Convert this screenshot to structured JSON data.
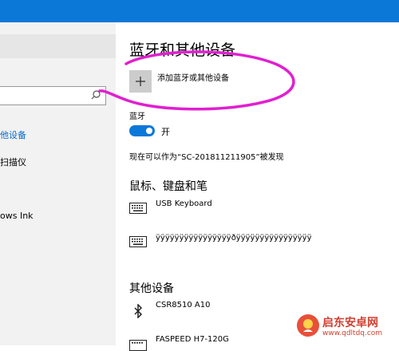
{
  "sidebar": {
    "search": {
      "placeholder": ""
    },
    "items": [
      {
        "label": "他设备"
      },
      {
        "label": "扫描仪"
      },
      {
        "label": "ows Ink"
      }
    ]
  },
  "main": {
    "title": "蓝牙和其他设备",
    "add_device_label": "添加蓝牙或其他设备",
    "bluetooth": {
      "label": "蓝牙",
      "toggle_state": "开",
      "discoverable_text": "现在可以作为“SC-201811211905”被发现"
    },
    "mouse_keyboard": {
      "title": "鼠标、键盘和笔",
      "devices": [
        {
          "name": "USB Keyboard",
          "icon": "keyboard-icon"
        },
        {
          "name": "ÿÿÿÿÿÿÿÿÿÿÿÿÿÿÿÿðÿÿÿÿÿÿÿÿÿÿÿÿÿÿÿÿ",
          "icon": "keyboard-icon"
        }
      ]
    },
    "other_devices": {
      "title": "其他设备",
      "devices": [
        {
          "name": "CSR8510 A10",
          "icon": "bluetooth-icon"
        },
        {
          "name": "FASPEED H7-120G",
          "icon": "keyboard-icon"
        }
      ]
    }
  },
  "watermark": {
    "title": "启东安卓网",
    "url": "www.qdltdq.com"
  },
  "colors": {
    "accent": "#0b78d7",
    "annotation": "#e020d0"
  }
}
